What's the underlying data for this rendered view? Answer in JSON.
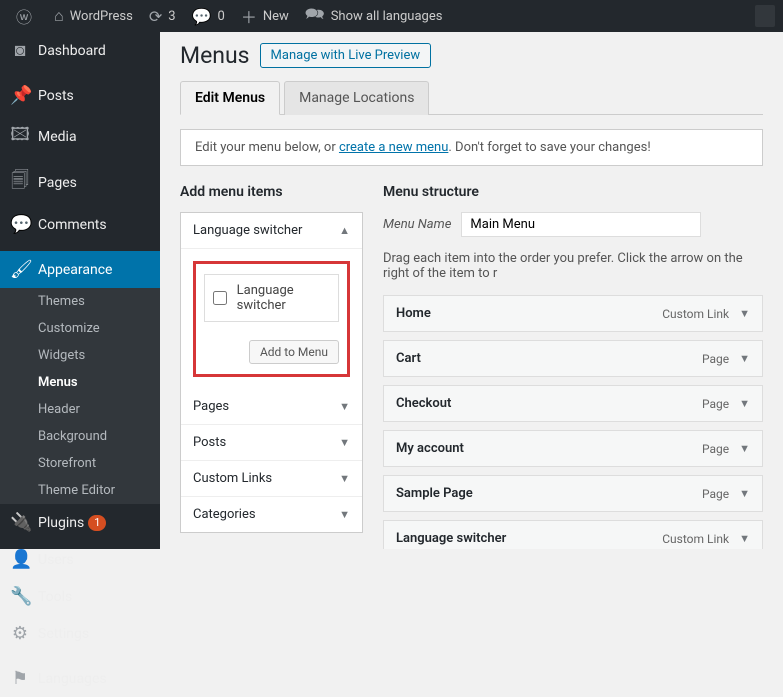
{
  "topbar": {
    "site": "WordPress",
    "refresh_count": "3",
    "comments_count": "0",
    "new_label": "New",
    "lang_label": "Show all languages"
  },
  "sidebar": {
    "items": [
      {
        "label": "Dashboard",
        "icon": "⌂"
      },
      {
        "label": "Posts",
        "icon": "✎"
      },
      {
        "label": "Media",
        "icon": "🖾"
      },
      {
        "label": "Pages",
        "icon": "🗐"
      },
      {
        "label": "Comments",
        "icon": "💬"
      },
      {
        "label": "Appearance",
        "icon": "🖌"
      },
      {
        "label": "Plugins",
        "icon": "🔌",
        "badge": "1"
      },
      {
        "label": "Users",
        "icon": "👤"
      },
      {
        "label": "Tools",
        "icon": "🔧"
      },
      {
        "label": "Settings",
        "icon": "⚙"
      },
      {
        "label": "Languages",
        "icon": "⚑"
      }
    ],
    "appearance_submenu": [
      "Themes",
      "Customize",
      "Widgets",
      "Menus",
      "Header",
      "Background",
      "Storefront",
      "Theme Editor"
    ],
    "appearance_current": "Menus"
  },
  "page": {
    "title": "Menus",
    "preview_btn": "Manage with Live Preview",
    "tabs": [
      "Edit Menus",
      "Manage Locations"
    ],
    "active_tab": "Edit Menus",
    "notice_prefix": "Edit your menu below, or ",
    "notice_link": "create a new menu",
    "notice_suffix": ". Don't forget to save your changes!"
  },
  "add_items": {
    "title": "Add menu items",
    "lang_switcher_header": "Language switcher",
    "lang_switcher_checkbox": "Language switcher",
    "add_btn": "Add to Menu",
    "panels": [
      "Pages",
      "Posts",
      "Custom Links",
      "Categories"
    ]
  },
  "structure": {
    "title": "Menu structure",
    "name_label": "Menu Name",
    "name_value": "Main Menu",
    "hint": "Drag each item into the order you prefer. Click the arrow on the right of the item to r",
    "items": [
      {
        "label": "Home",
        "type": "Custom Link"
      },
      {
        "label": "Cart",
        "type": "Page"
      },
      {
        "label": "Checkout",
        "type": "Page"
      },
      {
        "label": "My account",
        "type": "Page"
      },
      {
        "label": "Sample Page",
        "type": "Page"
      },
      {
        "label": "Language switcher",
        "type": "Custom Link"
      }
    ]
  }
}
